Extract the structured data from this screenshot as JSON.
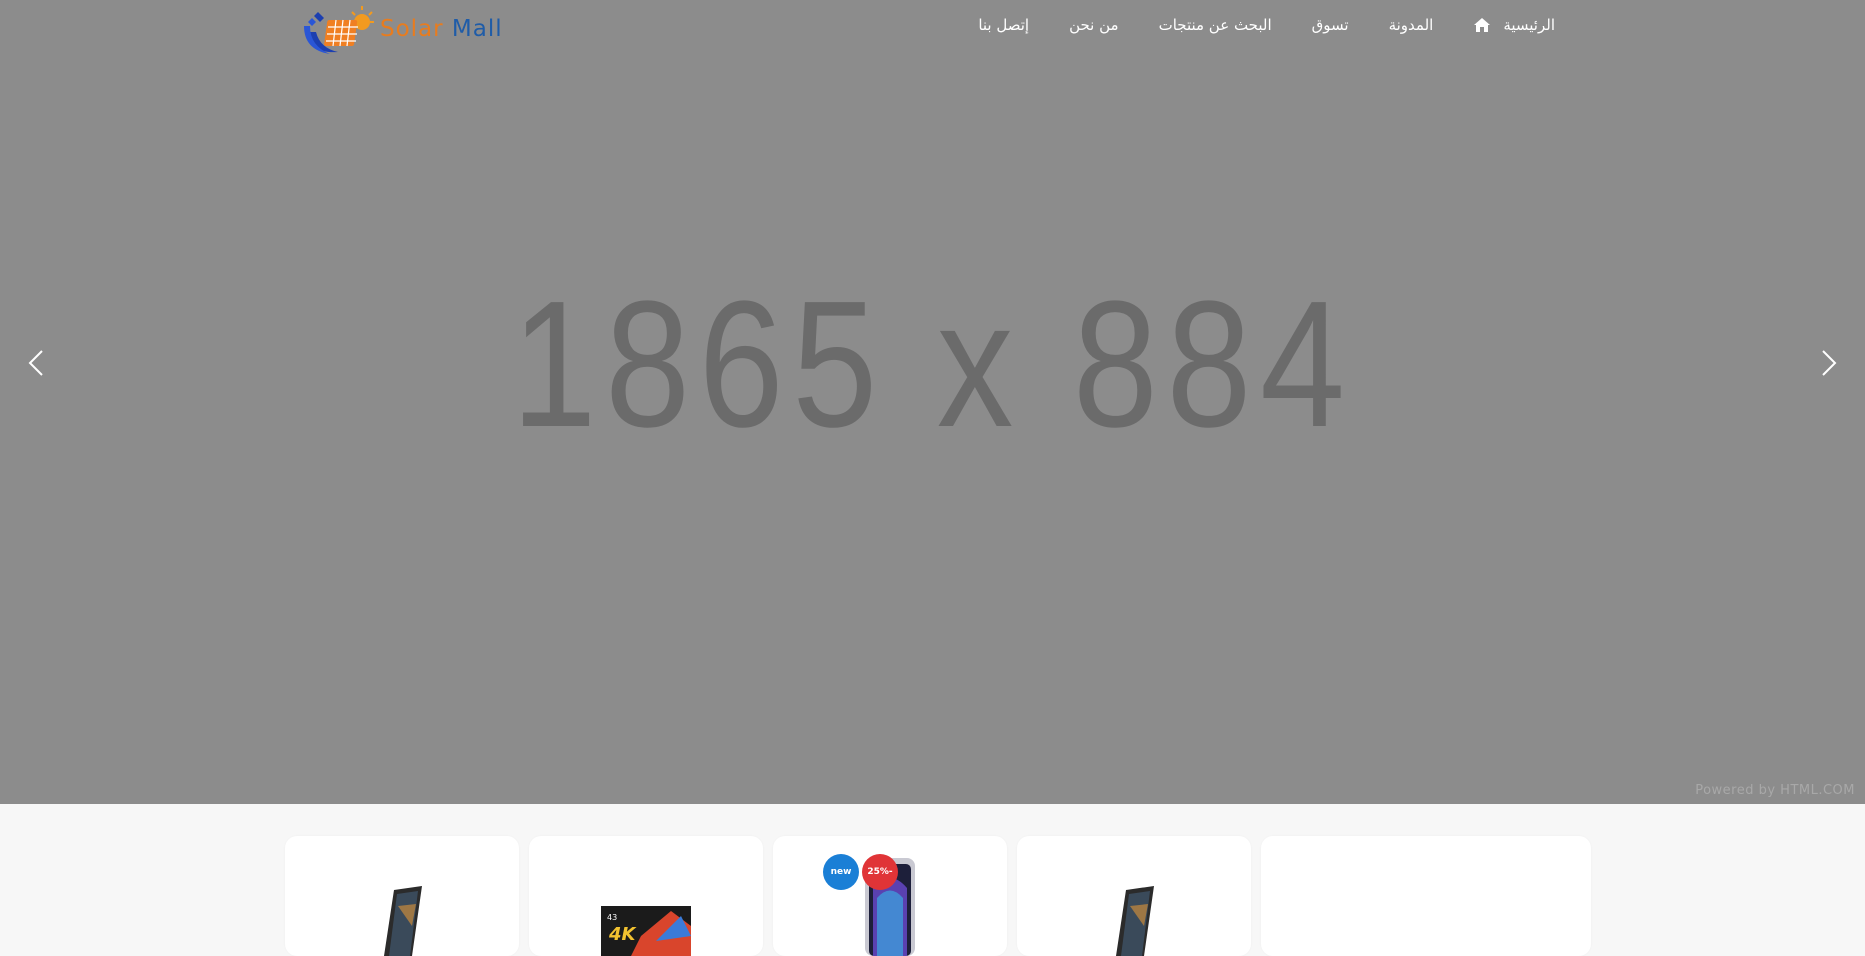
{
  "logo": {
    "text_part1": "Solar",
    "text_part2": " Mall"
  },
  "nav": {
    "items": [
      {
        "label": "الرئيسية",
        "icon": "home-icon"
      },
      {
        "label": "المدونة"
      },
      {
        "label": "تسوق"
      },
      {
        "label": "البحث عن منتجات"
      },
      {
        "label": "من نحن"
      },
      {
        "label": "إتصل بنا"
      }
    ]
  },
  "slider": {
    "placeholder_text": "1865 x 884",
    "powered_by": "Powered by HTML.COM"
  },
  "products": {
    "cards": [
      {
        "image": "phone-image"
      },
      {
        "image": "tv-image",
        "tv_label": "4K"
      },
      {
        "image": "phone-image",
        "badge_new": "new",
        "badge_sale": "25%-"
      },
      {
        "image": "phone-image"
      },
      {
        "image": ""
      }
    ]
  },
  "colors": {
    "hero_bg": "#8c8c8c",
    "badge_new": "#1a7fd6",
    "badge_sale": "#e03437",
    "logo_orange": "#e87c1e",
    "logo_blue": "#1f5ca8"
  }
}
